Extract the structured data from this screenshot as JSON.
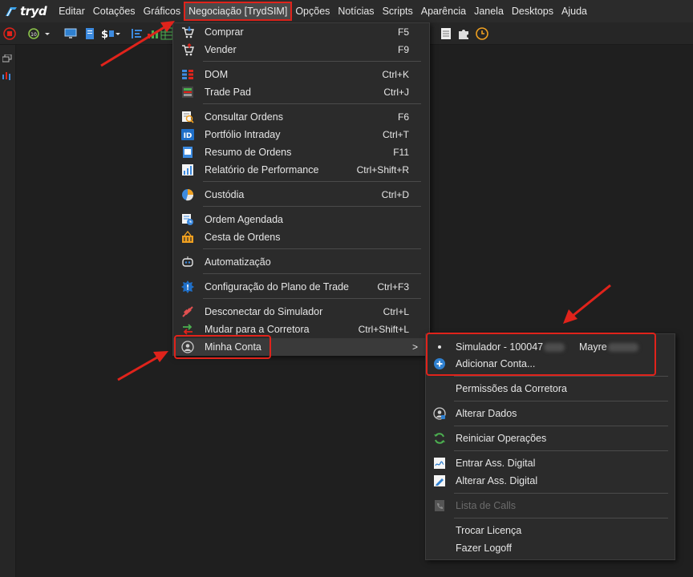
{
  "app": {
    "logo_text": "tryd"
  },
  "menubar": {
    "items": [
      "Editar",
      "Cotações",
      "Gráficos",
      "Negociação [TrydSIM]",
      "Opções",
      "Notícias",
      "Scripts",
      "Aparência",
      "Janela",
      "Desktops",
      "Ajuda"
    ]
  },
  "dropdown": {
    "items": [
      {
        "label": "Comprar",
        "shortcut": "F5",
        "icon": "buy-cart-icon"
      },
      {
        "label": "Vender",
        "shortcut": "F9",
        "icon": "sell-cart-icon"
      },
      {
        "label": "DOM",
        "shortcut": "Ctrl+K",
        "icon": "dom-book-icon"
      },
      {
        "label": "Trade Pad",
        "shortcut": "Ctrl+J",
        "icon": "trade-pad-icon"
      },
      {
        "label": "Consultar Ordens",
        "shortcut": "F6",
        "icon": "search-orders-icon"
      },
      {
        "label": "Portfólio Intraday",
        "shortcut": "Ctrl+T",
        "icon": "id-icon"
      },
      {
        "label": "Resumo de Ordens",
        "shortcut": "F11",
        "icon": "orders-summary-icon"
      },
      {
        "label": "Relatório de Performance",
        "shortcut": "Ctrl+Shift+R",
        "icon": "performance-report-icon"
      },
      {
        "label": "Custódia",
        "shortcut": "Ctrl+D",
        "icon": "pie-chart-icon"
      },
      {
        "label": "Ordem Agendada",
        "shortcut": "",
        "icon": "scheduled-order-icon"
      },
      {
        "label": "Cesta de Ordens",
        "shortcut": "",
        "icon": "basket-icon"
      },
      {
        "label": "Automatização",
        "shortcut": "",
        "icon": "robot-icon"
      },
      {
        "label": "Configuração do Plano de Trade",
        "shortcut": "Ctrl+F3",
        "icon": "gear-badge-icon"
      },
      {
        "label": "Desconectar do Simulador",
        "shortcut": "Ctrl+L",
        "icon": "disconnect-icon"
      },
      {
        "label": "Mudar para a Corretora",
        "shortcut": "Ctrl+Shift+L",
        "icon": "switch-arrows-icon"
      },
      {
        "label": "Minha Conta",
        "shortcut": "",
        "icon": "user-circle-icon",
        "submenu_arrow": ">"
      }
    ]
  },
  "submenu": {
    "account_prefix": "Simulador - 100047",
    "account_name": "Mayre",
    "items": [
      {
        "label": "Adicionar Conta...",
        "icon": "add-circle-icon"
      },
      {
        "label": "Permissões da Corretora",
        "icon": ""
      },
      {
        "label": "Alterar Dados",
        "icon": "user-edit-icon"
      },
      {
        "label": "Reiniciar Operações",
        "icon": "refresh-icon"
      },
      {
        "label": "Entrar Ass. Digital",
        "icon": "digital-signature-icon"
      },
      {
        "label": "Alterar Ass. Digital",
        "icon": "edit-signature-icon"
      },
      {
        "label": "Lista de Calls",
        "icon": "phone-list-icon",
        "disabled": true
      },
      {
        "label": "Trocar Licença",
        "icon": ""
      },
      {
        "label": "Fazer Logoff",
        "icon": ""
      }
    ]
  },
  "colors": {
    "annotation_red": "#e0231b",
    "menu_bg": "#2b2b2b",
    "highlight": "#3a3a3a"
  }
}
